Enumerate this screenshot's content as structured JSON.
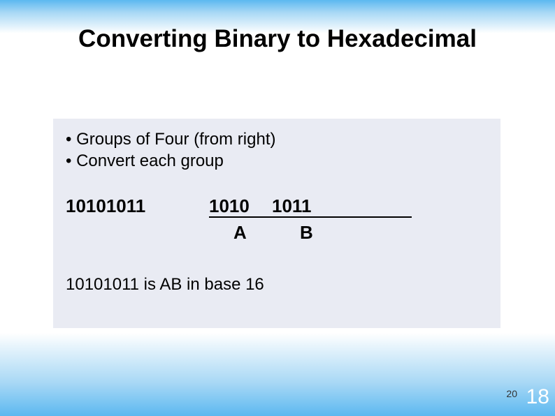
{
  "title": "Converting Binary to Hexadecimal",
  "bullets": [
    "Groups of Four (from right)",
    "Convert each group"
  ],
  "conversion": {
    "source_binary": "10101011",
    "group1_bin": "1010",
    "group2_bin": "1011",
    "group1_hex": "A",
    "group2_hex": "B"
  },
  "result_line": "10101011 is AB in base 16",
  "footer_small": "20",
  "footer_big": "18"
}
